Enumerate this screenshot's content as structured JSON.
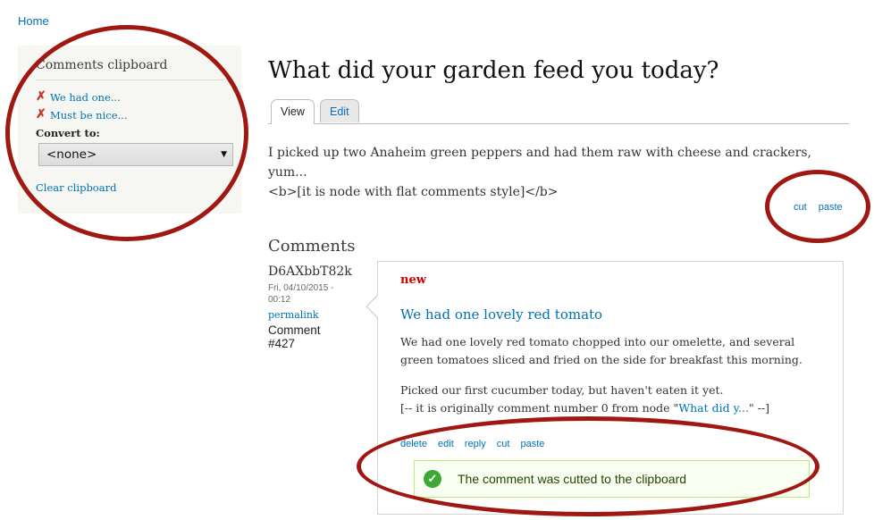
{
  "breadcrumb": {
    "home": "Home"
  },
  "sidebar": {
    "title": "Comments clipboard",
    "items": [
      {
        "label": "We had one..."
      },
      {
        "label": "Must be nice..."
      }
    ],
    "convert_label": "Convert to:",
    "convert_value": "<none>",
    "clear_label": "Clear clipboard"
  },
  "node": {
    "title": "What did your garden feed you today?",
    "tabs": [
      {
        "label": "View"
      },
      {
        "label": "Edit"
      }
    ],
    "body_line1": "I picked up two Anaheim green peppers and had them raw with cheese and crackers, yum...",
    "body_line2": "<b>[it is node with flat comments style]</b>",
    "links": {
      "cut": "cut",
      "paste": "paste"
    }
  },
  "comments": {
    "heading": "Comments",
    "comment": {
      "author": "D6AXbbT82k",
      "date_line1": "Fri, 04/10/2015 -",
      "date_line2": "00:12",
      "permalink": "permalink",
      "num_line1": "Comment",
      "num_line2": "#427",
      "new_label": "new",
      "title": "We had one lovely red tomato",
      "para1": "We had one lovely red tomato chopped into our omelette, and several green tomatoes sliced and fried on the side for breakfast this morning.",
      "para2_line1": "Picked our first cucumber today, but haven't eaten it yet.",
      "para2_prefix": "[-- it is originally comment number 0 from node \"",
      "para2_link": "What did y...",
      "para2_suffix": "\" --]",
      "links": {
        "delete": "delete",
        "edit": "edit",
        "reply": "reply",
        "cut": "cut",
        "paste": "paste"
      },
      "status_message": "The comment was cutted to the clipboard"
    }
  },
  "colors": {
    "link": "#0071b3",
    "annotation": "#a01812",
    "success": "#3da835",
    "new": "#cc0000"
  }
}
